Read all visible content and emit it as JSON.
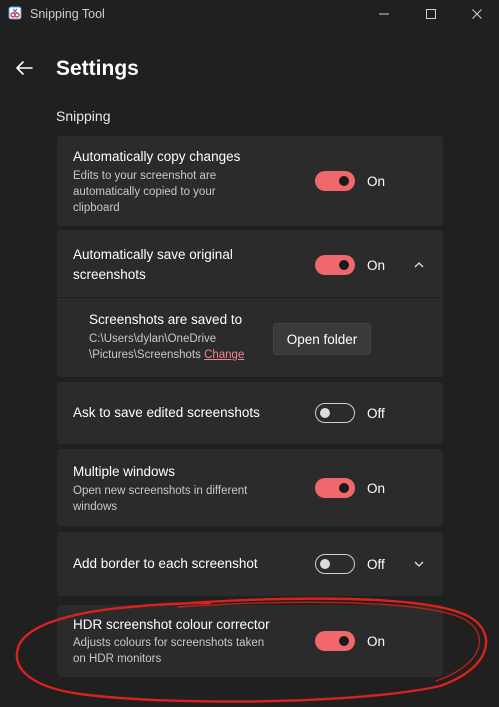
{
  "window": {
    "title": "Snipping Tool",
    "controls": [
      "minimize",
      "maximize",
      "close"
    ]
  },
  "page": {
    "title": "Settings",
    "section": "Snipping"
  },
  "settings": [
    {
      "title": "Automatically copy changes",
      "description": [
        "Edits to your screenshot are",
        "automatically copied to your",
        "clipboard"
      ],
      "enabled": true,
      "state_label": "On"
    },
    {
      "title": [
        "Automatically save original",
        "screenshots"
      ],
      "enabled": true,
      "state_label": "On",
      "expanded": true,
      "sub": {
        "title": "Screenshots are saved to",
        "path_line1": "C:\\Users\\dylan\\OneDrive",
        "path_line2": "\\Pictures\\Screenshots",
        "change_label": "Change",
        "button_label": "Open folder"
      }
    },
    {
      "title": "Ask to save edited screenshots",
      "enabled": false,
      "state_label": "Off"
    },
    {
      "title": "Multiple windows",
      "description": [
        "Open new screenshots in different",
        "windows"
      ],
      "enabled": true,
      "state_label": "On"
    },
    {
      "title": "Add border to each screenshot",
      "enabled": false,
      "state_label": "Off",
      "expanded": false
    },
    {
      "title": "HDR screenshot colour corrector",
      "description": [
        "Adjusts colours for screenshots taken",
        "on HDR monitors"
      ],
      "enabled": true,
      "state_label": "On"
    }
  ],
  "colors": {
    "accent": "#f0676c",
    "background": "#202020",
    "card": "#2b2b2b",
    "annotation": "#d9221b"
  },
  "icons": {
    "back": "arrow-left-icon",
    "expand": "chevron-up-icon",
    "collapse": "chevron-down-icon"
  }
}
